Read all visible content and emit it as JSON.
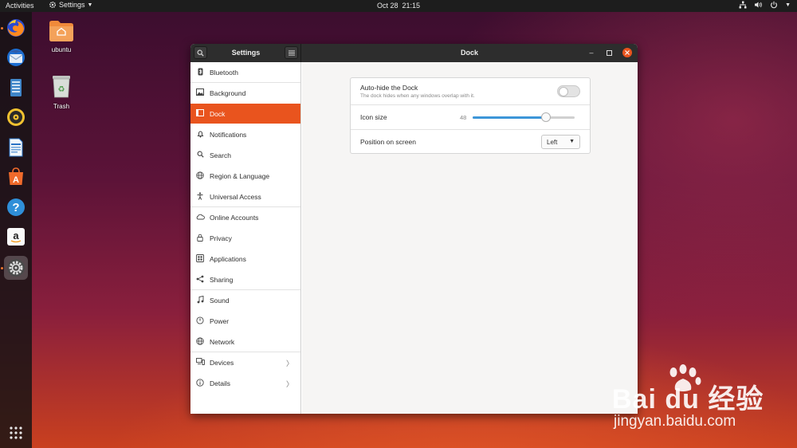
{
  "topbar": {
    "activities": "Activities",
    "app_menu": "Settings",
    "clock_date": "Oct 28",
    "clock_time": "21:15"
  },
  "dock": {
    "apps": [
      {
        "icon": "firefox-icon"
      },
      {
        "icon": "thunderbird-icon"
      },
      {
        "icon": "files-icon"
      },
      {
        "icon": "rhythmbox-icon"
      },
      {
        "icon": "writer-icon"
      },
      {
        "icon": "software-center-icon"
      },
      {
        "icon": "help-icon"
      },
      {
        "icon": "amazon-icon"
      },
      {
        "icon": "settings-icon",
        "active": true
      },
      {
        "icon": "show-apps-icon"
      }
    ]
  },
  "desktop": {
    "home_label": "ubuntu",
    "trash_label": "Trash"
  },
  "window": {
    "sidebar_title": "Settings",
    "panel_title": "Dock"
  },
  "sidebar": {
    "items": [
      {
        "label": "Bluetooth"
      },
      {
        "label": "Background"
      },
      {
        "label": "Dock"
      },
      {
        "label": "Notifications"
      },
      {
        "label": "Search"
      },
      {
        "label": "Region & Language"
      },
      {
        "label": "Universal Access"
      },
      {
        "label": "Online Accounts"
      },
      {
        "label": "Privacy"
      },
      {
        "label": "Applications"
      },
      {
        "label": "Sharing"
      },
      {
        "label": "Sound"
      },
      {
        "label": "Power"
      },
      {
        "label": "Network"
      },
      {
        "label": "Devices"
      },
      {
        "label": "Details"
      }
    ],
    "active": "Dock"
  },
  "dock_settings": {
    "autohide_label": "Auto-hide the Dock",
    "autohide_desc": "The dock hides when any windows overlap with it.",
    "autohide_on": false,
    "icon_size_label": "Icon size",
    "icon_size_value": "48",
    "icon_size_fraction": 0.72,
    "position_label": "Position on screen",
    "position_value": "Left"
  },
  "colors": {
    "accent": "#e9541e",
    "slider": "#3d96d8"
  },
  "watermark": {
    "brand": "Bai du 经验",
    "url": "jingyan.baidu.com"
  }
}
